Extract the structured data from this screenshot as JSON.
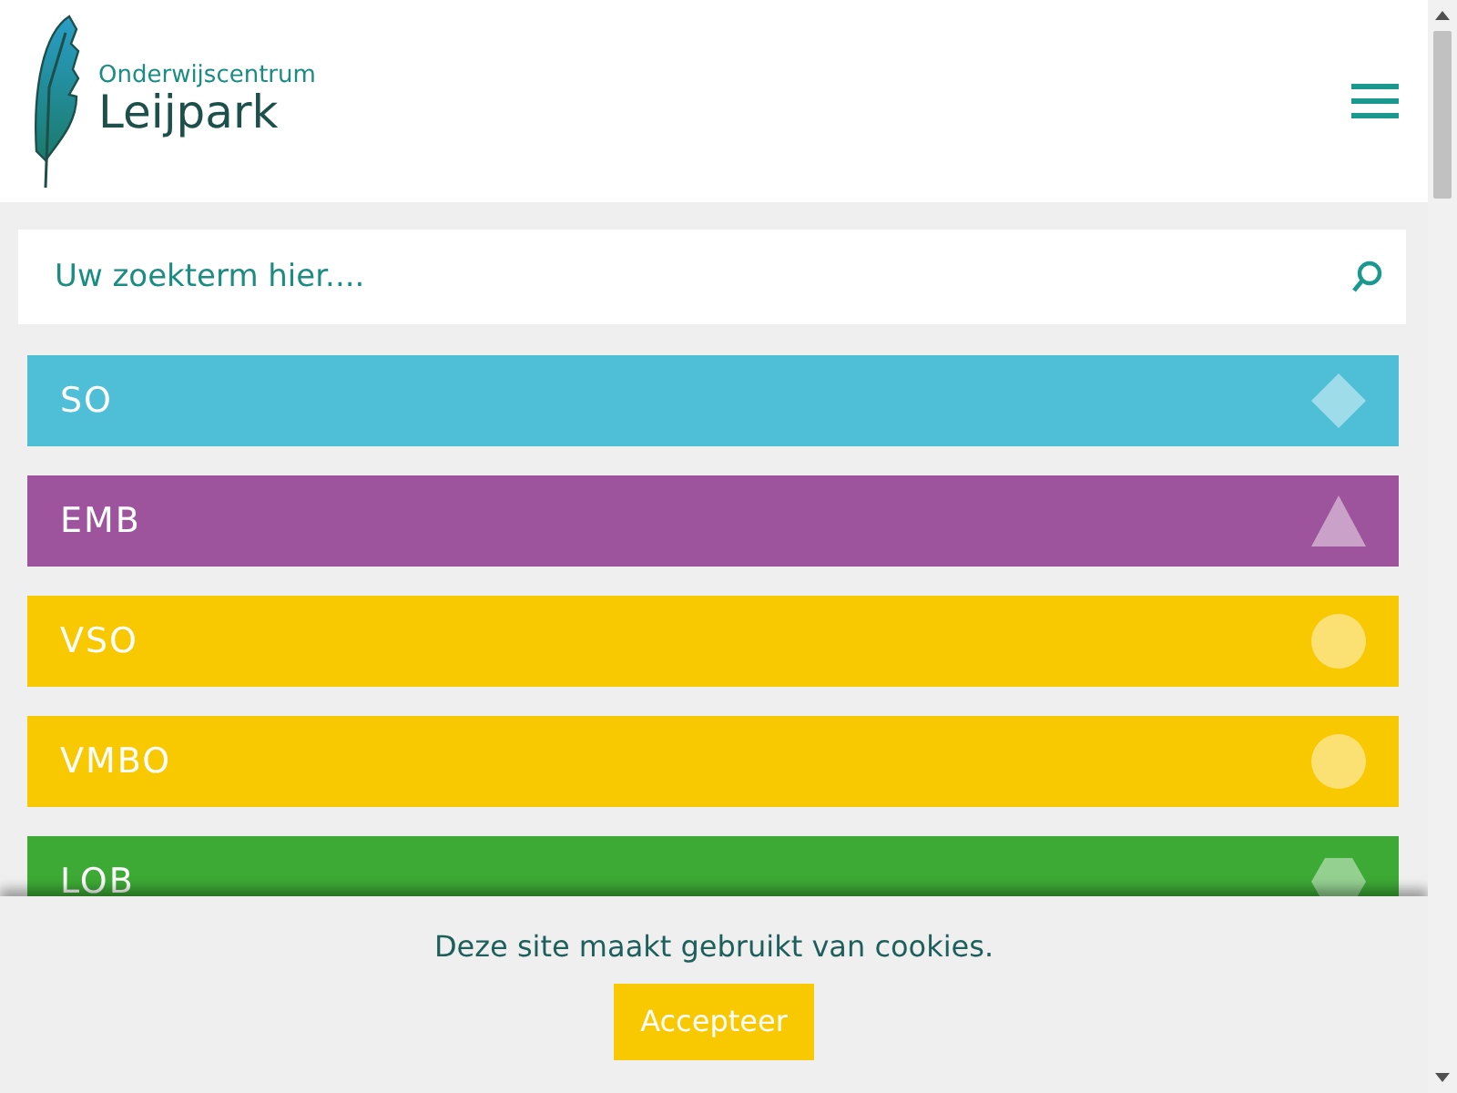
{
  "header": {
    "logo_subtitle": "Onderwijscentrum",
    "logo_title": "Leijpark"
  },
  "search": {
    "placeholder": "Uw zoekterm hier...."
  },
  "categories": [
    {
      "label": "SO",
      "color": "#4fbfd8",
      "kind": "diamond"
    },
    {
      "label": "EMB",
      "color": "#9e549c",
      "kind": "triangle"
    },
    {
      "label": "VSO",
      "color": "#f8c800",
      "kind": "circle"
    },
    {
      "label": "VMBO",
      "color": "#f8c800",
      "kind": "circle"
    },
    {
      "label": "LOB",
      "color": "#3daa35",
      "kind": "hexagon"
    }
  ],
  "cookie_bar": {
    "message": "Deze site maakt gebruikt van cookies.",
    "button": "Accepteer"
  }
}
